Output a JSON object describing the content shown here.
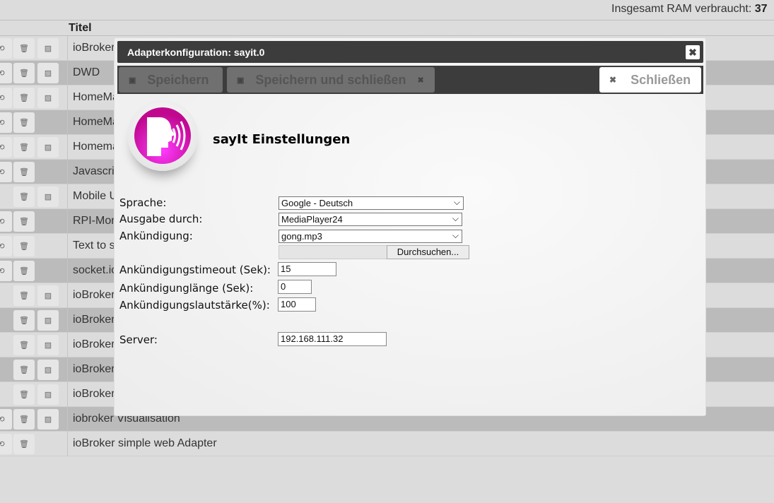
{
  "header": {
    "ram_label": "Insgesamt RAM verbraucht:",
    "ram_value": "37"
  },
  "table": {
    "title_header": "Titel",
    "rows": [
      {
        "title": "ioBroker",
        "reload": true,
        "image": true,
        "alt": false
      },
      {
        "title": "DWD",
        "reload": true,
        "image": true,
        "alt": true
      },
      {
        "title": "HomeMa",
        "reload": true,
        "image": true,
        "alt": false
      },
      {
        "title": "HomeMa",
        "reload": true,
        "image": false,
        "alt": true
      },
      {
        "title": "Homema",
        "reload": true,
        "image": true,
        "alt": false
      },
      {
        "title": "Javascri",
        "reload": true,
        "image": false,
        "alt": true
      },
      {
        "title": "Mobile U",
        "reload": false,
        "image": true,
        "alt": false
      },
      {
        "title": "RPI-Mon",
        "reload": true,
        "image": false,
        "alt": true
      },
      {
        "title": "Text to s",
        "reload": true,
        "image": false,
        "alt": false
      },
      {
        "title": "socket.io",
        "reload": true,
        "image": false,
        "alt": true
      },
      {
        "title": "ioBroker",
        "reload": false,
        "image": true,
        "alt": false
      },
      {
        "title": "ioBroker",
        "reload": false,
        "image": true,
        "alt": true
      },
      {
        "title": "ioBroker",
        "reload": false,
        "image": true,
        "alt": false
      },
      {
        "title": "ioBroker",
        "reload": false,
        "image": true,
        "alt": true
      },
      {
        "title": "ioBroker",
        "reload": false,
        "image": true,
        "alt": false
      },
      {
        "title": "iobroker Visualisation",
        "reload": true,
        "image": true,
        "alt": true
      },
      {
        "title": "ioBroker simple web Adapter",
        "reload": true,
        "image": false,
        "alt": false
      }
    ]
  },
  "dialog": {
    "title": "Adapterkonfiguration: sayit.0",
    "save": "Speichern",
    "save_close": "Speichern und schließen",
    "close": "Schließen",
    "heading": "sayIt Einstellungen",
    "fields": {
      "sprache_label": "Sprache:",
      "sprache_value": "Google - Deutsch",
      "ausgabe_label": "Ausgabe durch:",
      "ausgabe_value": "MediaPlayer24",
      "ankuendigung_label": "Ankündigung:",
      "ankuendigung_value": "gong.mp3",
      "browse": "Durchsuchen...",
      "timeout_label": "Ankündigungstimeout (Sek):",
      "timeout_value": "15",
      "laenge_label": "Ankündigunglänge (Sek):",
      "laenge_value": "0",
      "lautstaerke_label": "Ankündigungslautstärke(%):",
      "lautstaerke_value": "100",
      "server_label": "Server:",
      "server_value": "192.168.111.32"
    }
  }
}
